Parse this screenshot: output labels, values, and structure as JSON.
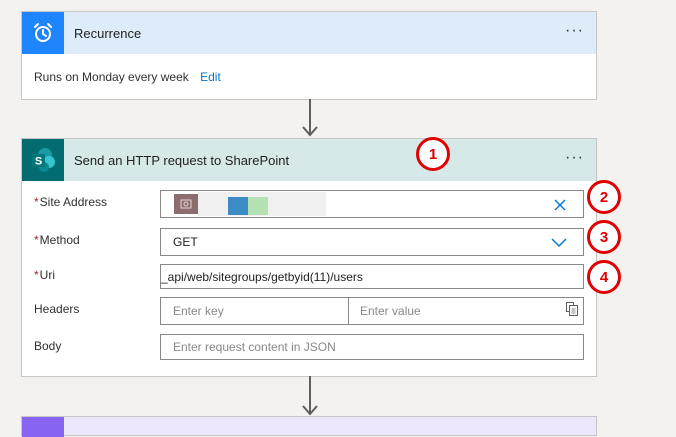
{
  "recurrence": {
    "title": "Recurrence",
    "more_label": "···",
    "summary": "Runs on Monday every week",
    "edit_label": "Edit",
    "colors": {
      "header_bg": "#deecf9",
      "icon_bg": "#1f85ff"
    }
  },
  "http_action": {
    "title": "Send an HTTP request to SharePoint",
    "more_label": "···",
    "colors": {
      "header_bg": "#d6e8e8",
      "icon_bg": "#036c70"
    },
    "site_address": {
      "label": "Site Address",
      "required": "*",
      "value": ""
    },
    "method": {
      "label": "Method",
      "required": "*",
      "value": "GET"
    },
    "uri": {
      "label": "Uri",
      "required": "*",
      "value": "_api/web/sitegroups/getbyid(11)/users"
    },
    "headers": {
      "label": "Headers",
      "key_placeholder": "Enter key",
      "value_placeholder": "Enter value"
    },
    "body": {
      "label": "Body",
      "placeholder": "Enter request content in JSON"
    }
  },
  "callouts": [
    "1",
    "2",
    "3",
    "4"
  ]
}
